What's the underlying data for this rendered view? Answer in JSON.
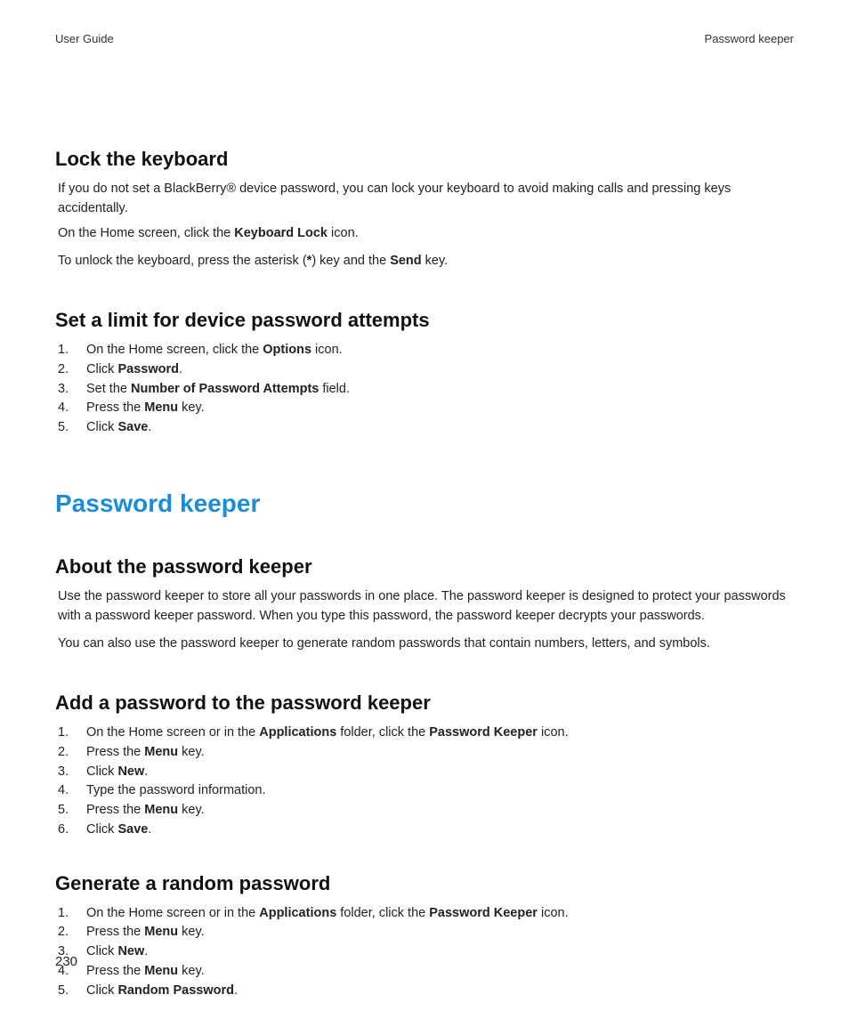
{
  "header": {
    "left": "User Guide",
    "right": "Password keeper"
  },
  "sec1": {
    "title": "Lock the keyboard",
    "p1_a": "If you do not set a BlackBerry® device password, you can lock your keyboard to avoid making calls and pressing keys accidentally.",
    "p2_a": "On the Home screen, click the ",
    "p2_b": "Keyboard Lock",
    "p2_c": " icon.",
    "p3_a": "To unlock the keyboard, press the asterisk (",
    "p3_b": "*",
    "p3_c": ") key and the ",
    "p3_d": "Send",
    "p3_e": " key."
  },
  "sec2": {
    "title": "Set a limit for device password attempts",
    "items": {
      "n1": "1.",
      "t1a": "On the Home screen, click the ",
      "t1b": "Options",
      "t1c": " icon.",
      "n2": "2.",
      "t2a": "Click ",
      "t2b": "Password",
      "t2c": ".",
      "n3": "3.",
      "t3a": "Set the ",
      "t3b": "Number of Password Attempts",
      "t3c": " field.",
      "n4": "4.",
      "t4a": "Press the ",
      "t4b": "Menu",
      "t4c": " key.",
      "n5": "5.",
      "t5a": "Click ",
      "t5b": "Save",
      "t5c": "."
    }
  },
  "chapter": {
    "title": "Password keeper"
  },
  "sec3": {
    "title": "About the password keeper",
    "p1": "Use the password keeper to store all your passwords in one place. The password keeper is designed to protect your passwords with a password keeper password. When you type this password, the password keeper decrypts your passwords.",
    "p2": "You can also use the password keeper to generate random passwords that contain numbers, letters, and symbols."
  },
  "sec4": {
    "title": "Add a password to the password keeper",
    "items": {
      "n1": "1.",
      "t1a": "On the Home screen or in the ",
      "t1b": "Applications",
      "t1c": " folder, click the ",
      "t1d": "Password Keeper",
      "t1e": " icon.",
      "n2": "2.",
      "t2a": "Press the ",
      "t2b": "Menu",
      "t2c": " key.",
      "n3": "3.",
      "t3a": "Click ",
      "t3b": "New",
      "t3c": ".",
      "n4": "4.",
      "t4a": "Type the password information.",
      "n5": "5.",
      "t5a": "Press the ",
      "t5b": "Menu",
      "t5c": " key.",
      "n6": "6.",
      "t6a": "Click ",
      "t6b": "Save",
      "t6c": "."
    }
  },
  "sec5": {
    "title": "Generate a random password",
    "items": {
      "n1": "1.",
      "t1a": "On the Home screen or in the ",
      "t1b": "Applications",
      "t1c": " folder, click the ",
      "t1d": "Password Keeper",
      "t1e": " icon.",
      "n2": "2.",
      "t2a": "Press the ",
      "t2b": "Menu",
      "t2c": " key.",
      "n3": "3.",
      "t3a": "Click ",
      "t3b": "New",
      "t3c": ".",
      "n4": "4.",
      "t4a": "Press the ",
      "t4b": "Menu",
      "t4c": " key.",
      "n5": "5.",
      "t5a": "Click ",
      "t5b": "Random Password",
      "t5c": "."
    }
  },
  "page": {
    "number": "230"
  }
}
